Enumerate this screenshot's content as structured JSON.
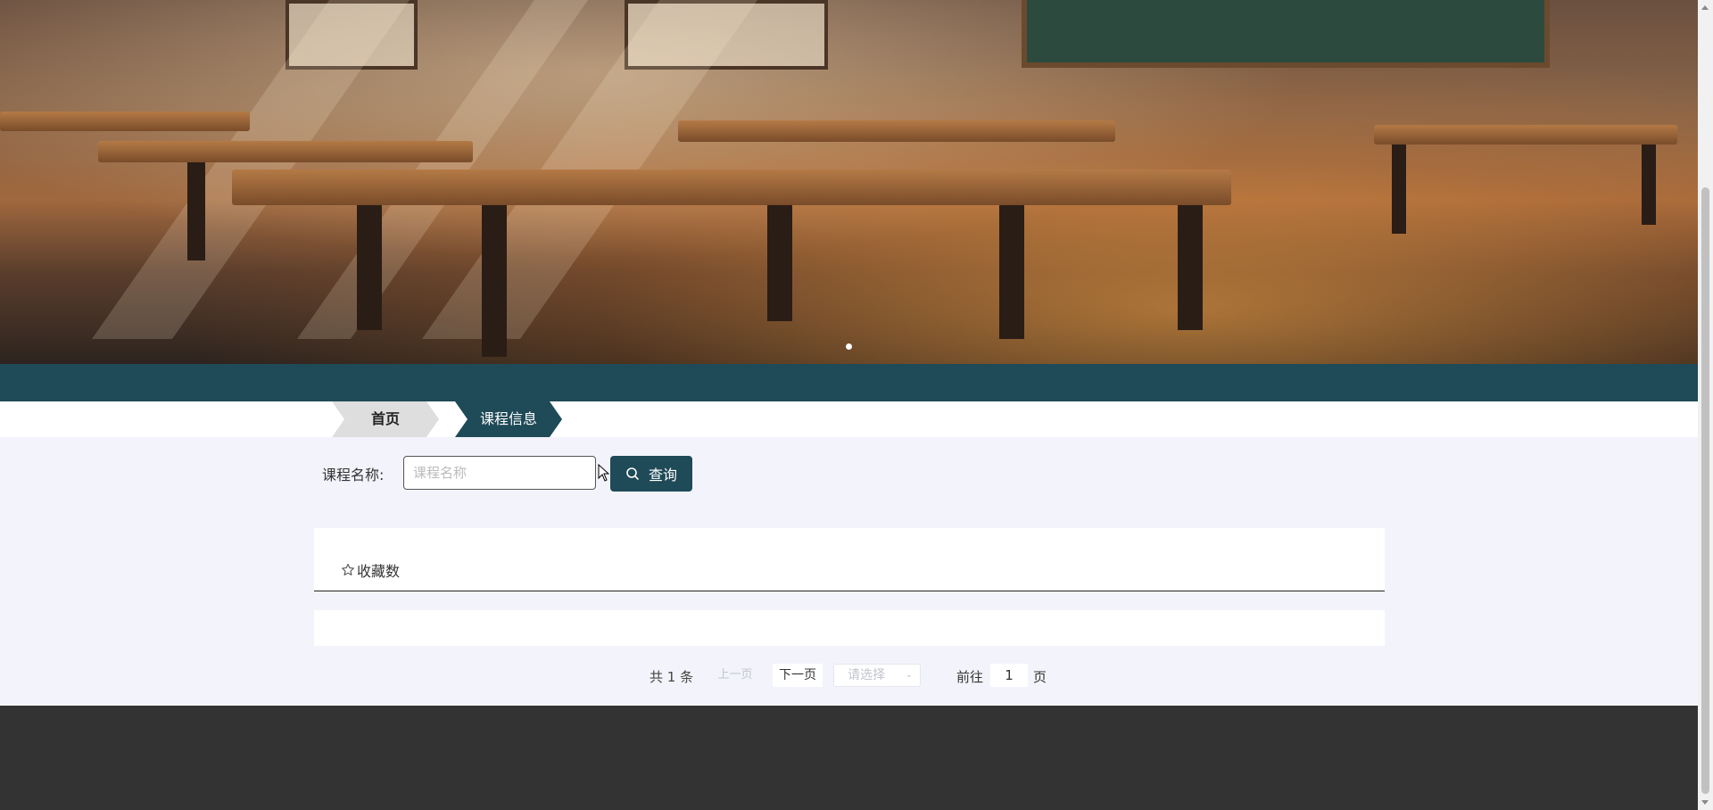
{
  "banner": {
    "image": "classroom-banner",
    "active_slide": 1,
    "slide_count": 1
  },
  "breadcrumb": {
    "home": "首页",
    "current": "课程信息"
  },
  "search": {
    "label": "课程名称:",
    "placeholder": "课程名称",
    "value": "",
    "button": "查询",
    "button_icon": "search-icon"
  },
  "tabs": {
    "favorites": "收藏数",
    "favorites_icon": "star-outline-icon"
  },
  "pagination": {
    "total": "共 1 条",
    "prev": "上一页",
    "next": "下一页",
    "page_size_placeholder": "请选择",
    "goto_label": "前往",
    "page_value": "1",
    "page_suffix": "页"
  },
  "colors": {
    "accent": "#1f4a57",
    "footer": "#333333",
    "background": "#f3f4fb"
  }
}
